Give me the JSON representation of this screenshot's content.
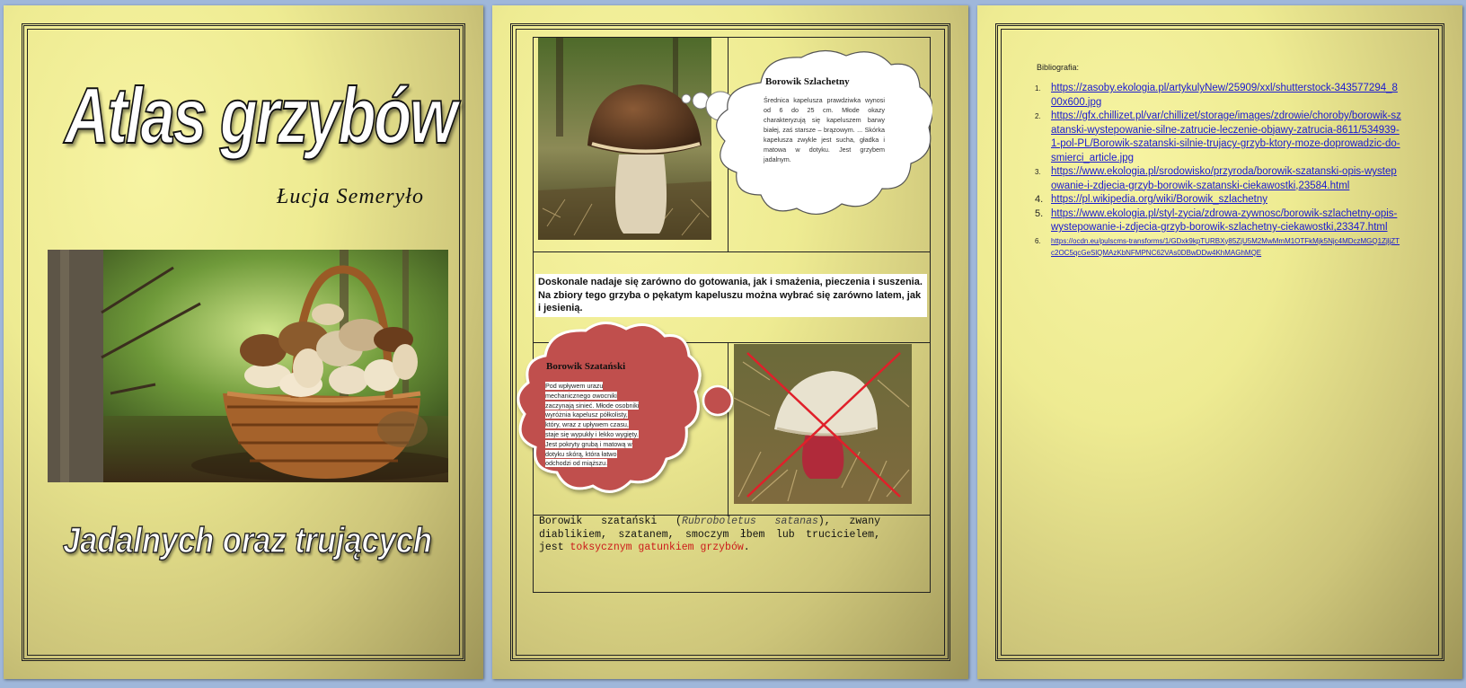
{
  "cover": {
    "title": "Atlas grzybów",
    "author": "Łucja Semeryło",
    "subtitle": "Jadalnych oraz trujących"
  },
  "page2": {
    "cloud1": {
      "title": "Borowik Szlachetny",
      "text": "Średnica kapelusza prawdziwka wynosi od 6 do 25 cm. Młode okazy charakteryzują się kapeluszem barwy białej, zaś starsze – brązowym. ... Skórka kapelusza zwykle jest sucha, gładka i matowa w dotyku. Jest grzybem jadalnym."
    },
    "description": "Doskonale nadaje się zarówno do gotowania, jak i smażenia, pieczenia i suszenia. Na zbiory tego grzyba o pękatym kapeluszu można wybrać się zarówno latem, jak i jesienią.",
    "cloud2": {
      "title": "Borowik Szatański",
      "lines": [
        "Pod wpływem urazu",
        "mechanicznego owocniki",
        "zaczynają sinieć. Młode osobniki",
        "wyróżnia kapelusz półkolisty,",
        "który, wraz z upływem czasu,",
        "staje się wypukły i lekko wygięty.",
        "Jest pokryty grubą i matową w",
        "dotyku skórą, która łatwo",
        "odchodzi od miąższu."
      ]
    },
    "poison": {
      "part1": "Borowik szatański (",
      "latin": "Rubroboletus satanas",
      "part2": "), zwany diablikiem, szatanem, smoczym łbem lub trucicielem, jest ",
      "red": "toksycznym gatunkiem grzybów",
      "part3": "."
    }
  },
  "page3": {
    "label": "Bibliografia:",
    "refs": [
      {
        "n": "1.",
        "url": "https://zasoby.ekologia.pl/artykulyNew/25909/xxl/shutterstock-343577294_800x600.jpg"
      },
      {
        "n": "2.",
        "url": "https://gfx.chillizet.pl/var/chillizet/storage/images/zdrowie/choroby/borowik-szatanski-wystepowanie-silne-zatrucie-leczenie-objawy-zatrucia-8611/534939-1-pol-PL/Borowik-szatanski-silnie-trujacy-grzyb-ktory-moze-doprowadzic-do-smierci_article.jpg"
      },
      {
        "n": "3.",
        "url": "https://www.ekologia.pl/srodowisko/przyroda/borowik-szatanski-opis-wystepowanie-i-zdjecia-grzyb-borowik-szatanski-ciekawostki,23584.html"
      },
      {
        "n": "4.",
        "url": "https://pl.wikipedia.org/wiki/Borowik_szlachetny"
      },
      {
        "n": "5.",
        "url": "https://www.ekologia.pl/styl-zycia/zdrowa-zywnosc/borowik-szlachetny-opis-wystepowanie-i-zdjecia-grzyb-borowik-szlachetny-ciekawostki,23347.html"
      },
      {
        "n": "6.",
        "url": "https://ocdn.eu/pulscms-transforms/1/GDxk9kpTURBXy85ZjU5M2MwMmM1OTFkMjk5Njc4MDczMGQ1ZjljZTc2OC5qcGeSlQMAzKbNFMPNC62VAs0DBwDDw4KhMAGhMQE"
      }
    ]
  }
}
